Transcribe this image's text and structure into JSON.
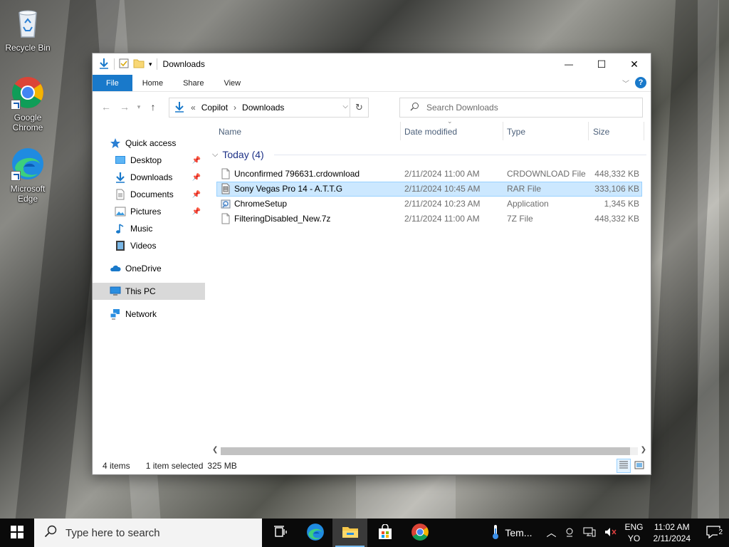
{
  "desktop": {
    "icons": [
      {
        "label": "Recycle Bin",
        "icon": "recycle-bin-icon"
      },
      {
        "label": "Google Chrome",
        "icon": "chrome-icon"
      },
      {
        "label": "Microsoft Edge",
        "icon": "edge-icon"
      }
    ]
  },
  "window": {
    "title": "Downloads",
    "controls": {
      "minimize": "—",
      "maximize": "☐",
      "close": "✕"
    },
    "ribbon": {
      "tabs": [
        "File",
        "Home",
        "Share",
        "View"
      ]
    },
    "address": {
      "prefix": "«",
      "path": [
        "Copilot",
        "Downloads"
      ],
      "separator": "›"
    },
    "search": {
      "placeholder": "Search Downloads"
    },
    "nav": {
      "quick_access": "Quick access",
      "items": [
        {
          "label": "Desktop",
          "pinned": true
        },
        {
          "label": "Downloads",
          "pinned": true
        },
        {
          "label": "Documents",
          "pinned": true
        },
        {
          "label": "Pictures",
          "pinned": true
        },
        {
          "label": "Music",
          "pinned": false
        },
        {
          "label": "Videos",
          "pinned": false
        }
      ],
      "onedrive": "OneDrive",
      "this_pc": "This PC",
      "network": "Network"
    },
    "columns": {
      "name": "Name",
      "date": "Date modified",
      "type": "Type",
      "size": "Size"
    },
    "group": {
      "label": "Today (4)"
    },
    "files": [
      {
        "name": "Unconfirmed 796631.crdownload",
        "date": "2/11/2024 11:00 AM",
        "type": "CRDOWNLOAD File",
        "size": "448,332 KB",
        "selected": false
      },
      {
        "name": "Sony Vegas Pro 14 - A.T.T.G",
        "date": "2/11/2024 10:45 AM",
        "type": "RAR File",
        "size": "333,106 KB",
        "selected": true
      },
      {
        "name": "ChromeSetup",
        "date": "2/11/2024 10:23 AM",
        "type": "Application",
        "size": "1,345 KB",
        "selected": false
      },
      {
        "name": "FilteringDisabled_New.7z",
        "date": "2/11/2024 11:00 AM",
        "type": "7Z File",
        "size": "448,332 KB",
        "selected": false
      }
    ],
    "status": {
      "items": "4 items",
      "selected": "1 item selected",
      "size": "325 MB"
    }
  },
  "taskbar": {
    "search_placeholder": "Type here to search",
    "weather": "Tem...",
    "lang_top": "ENG",
    "lang_bottom": "YO",
    "time": "11:02 AM",
    "date": "2/11/2024",
    "notifications": "2",
    "accent": "#76b9ed"
  }
}
